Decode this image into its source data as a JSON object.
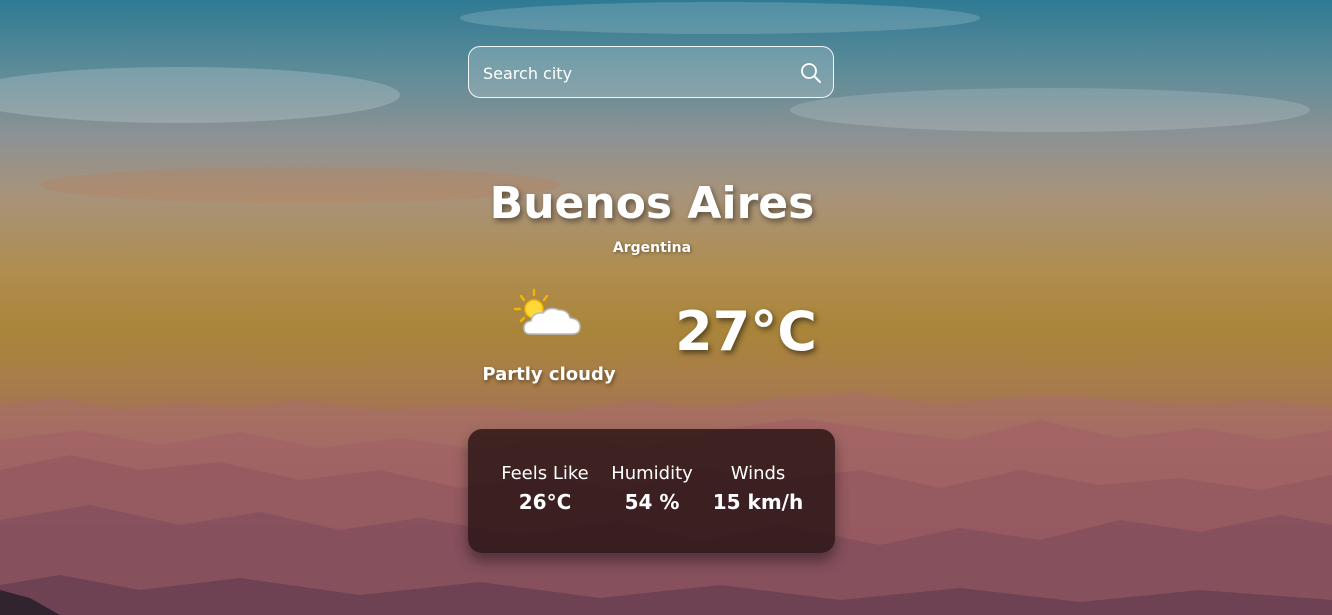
{
  "search": {
    "placeholder": "Search city",
    "icon": "search-icon"
  },
  "location": {
    "city": "Buenos Aires",
    "country": "Argentina"
  },
  "current": {
    "icon": "partly-cloudy-icon",
    "condition": "Partly cloudy",
    "temperature": "27°C"
  },
  "details": {
    "feels_like": {
      "label": "Feels Like",
      "value": "26°C"
    },
    "humidity": {
      "label": "Humidity",
      "value": "54 %"
    },
    "winds": {
      "label": "Winds",
      "value": "15 km/h"
    }
  }
}
